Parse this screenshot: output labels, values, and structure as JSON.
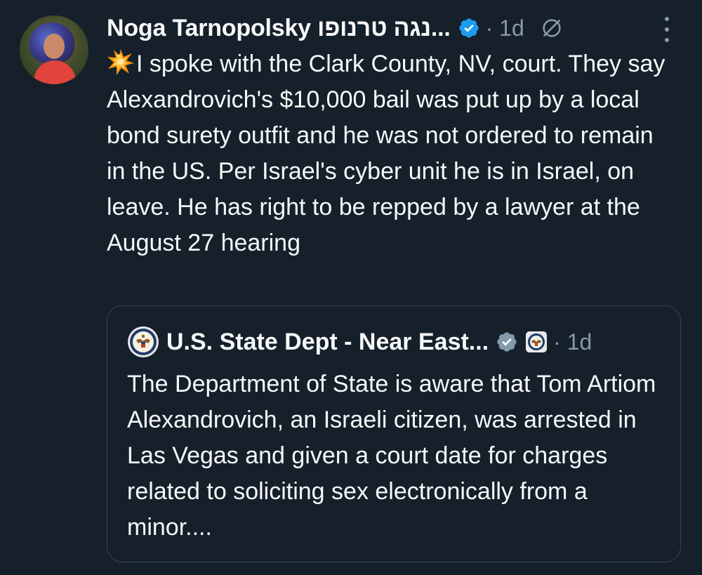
{
  "author": {
    "name": "Noga Tarnopolsky נגה טרנופו...",
    "time": "· 1d",
    "verified": true,
    "verified_icon": "verified-badge-icon",
    "no_reply_icon": "slash-circle-icon"
  },
  "tweet": {
    "emoji": "collision-emoji",
    "text": "I spoke with the Clark County, NV, court. They say Alexandrovich's $10,000 bail was put up by a local bond surety outfit and he was not ordered to remain in the US. Per Israel's cyber unit he is in Israel, on leave. He has right to be repped by a lawyer at the August 27 hearing"
  },
  "quoted": {
    "name": "U.S. State Dept - Near East...",
    "time": "· 1d",
    "text": "The Department of State is aware that Tom Artiom Alexandrovich, an Israeli citizen, was arrested in Las Vegas and given a court date for charges related to soliciting sex electronically from a minor...."
  },
  "colors": {
    "background": "#15202b",
    "text": "#f7f9f9",
    "secondary": "#8b98a5",
    "verified": "#1d9bf0",
    "border": "#38444d"
  }
}
